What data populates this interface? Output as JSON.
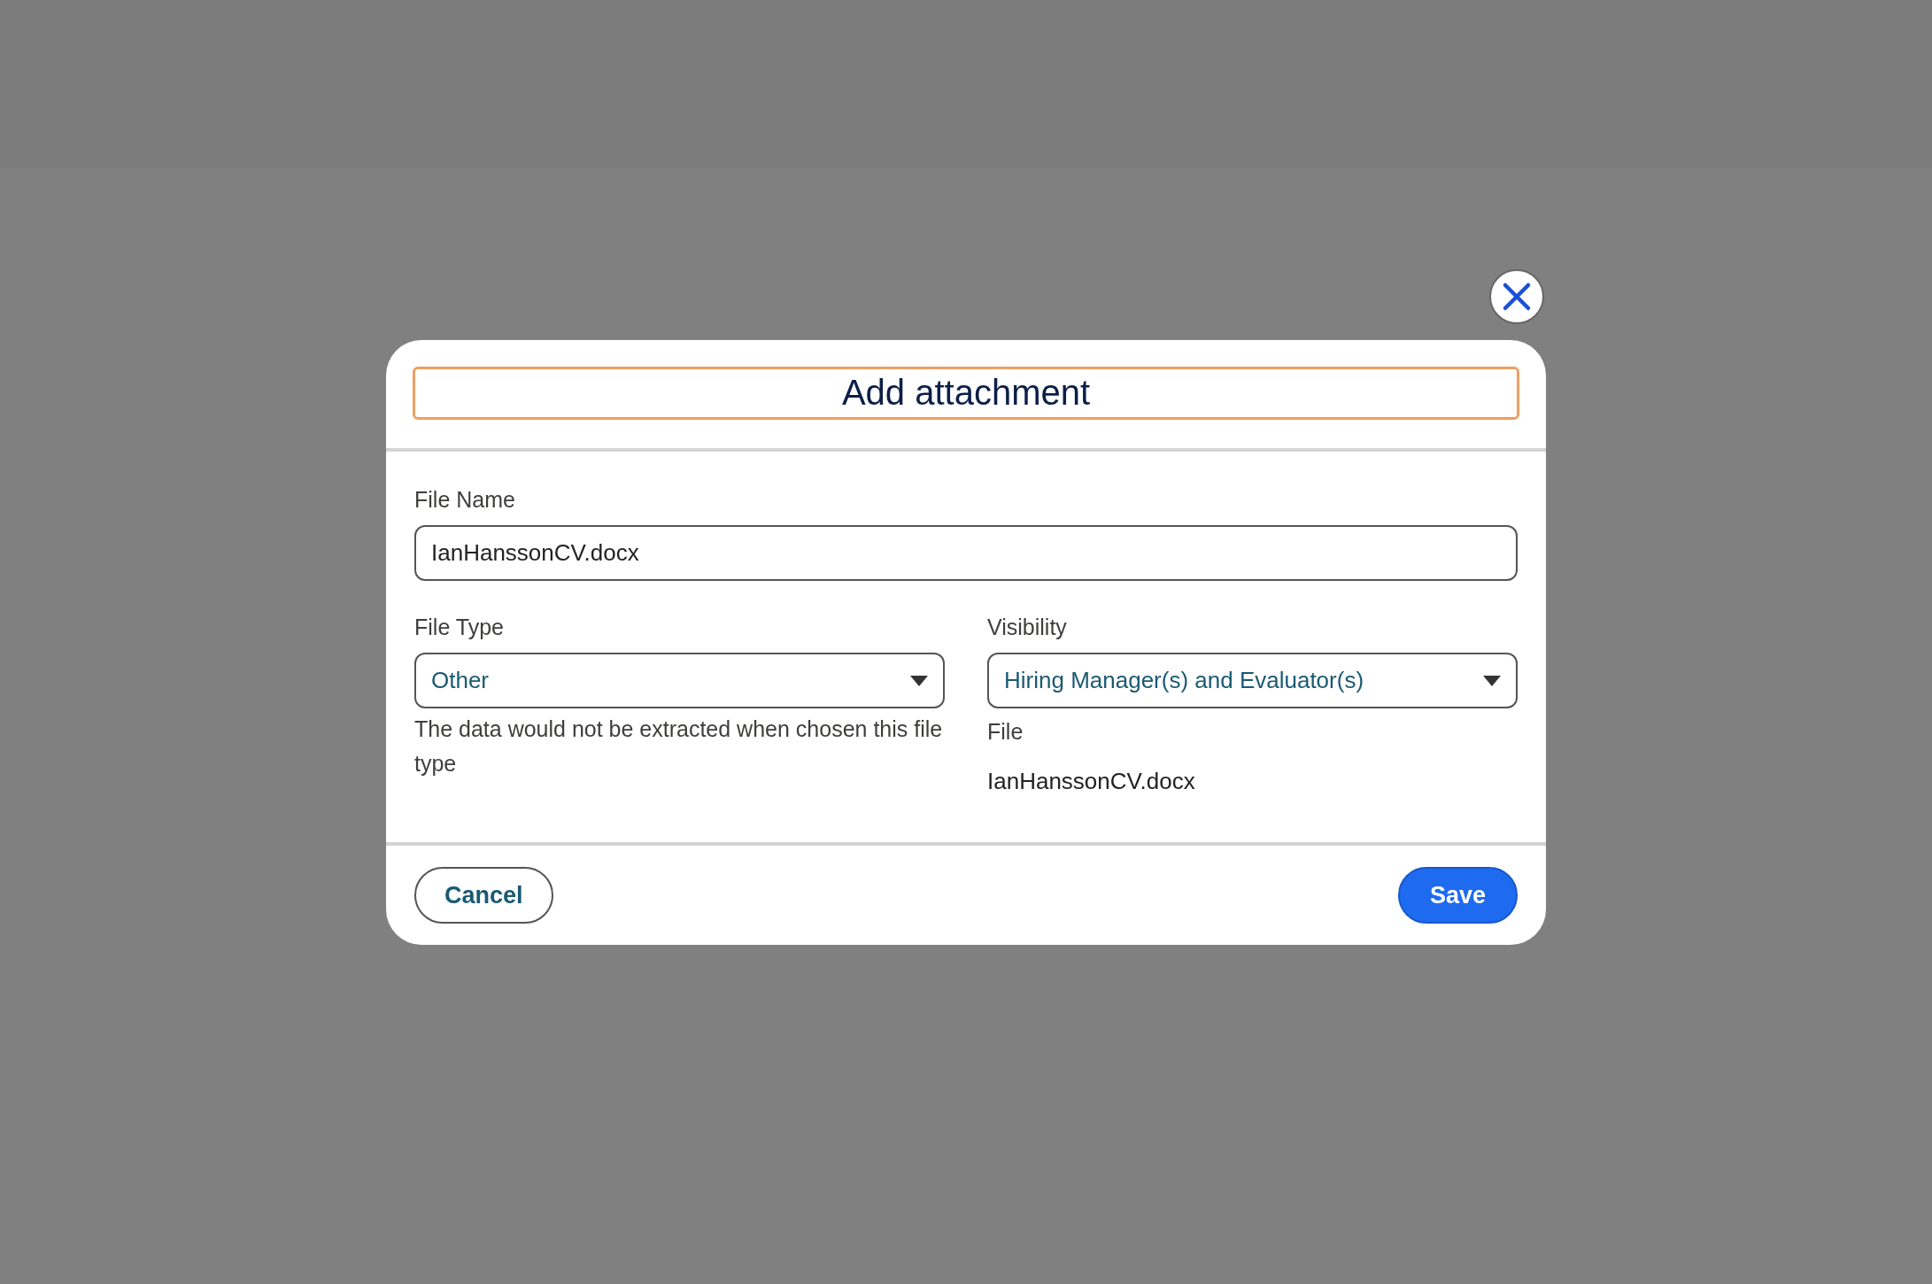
{
  "dialog": {
    "title": "Add attachment",
    "file_name": {
      "label": "File Name",
      "value": "IanHanssonCV.docx"
    },
    "file_type": {
      "label": "File Type",
      "value": "Other",
      "hint": "The data would not be extracted when chosen this file type"
    },
    "visibility": {
      "label": "Visibility",
      "value": "Hiring Manager(s) and Evaluator(s)"
    },
    "file": {
      "label": "File",
      "value": "IanHanssonCV.docx"
    },
    "buttons": [
      {
        "label": "Cancel",
        "kind": "secondary"
      },
      {
        "label": "Save",
        "kind": "primary"
      }
    ]
  }
}
